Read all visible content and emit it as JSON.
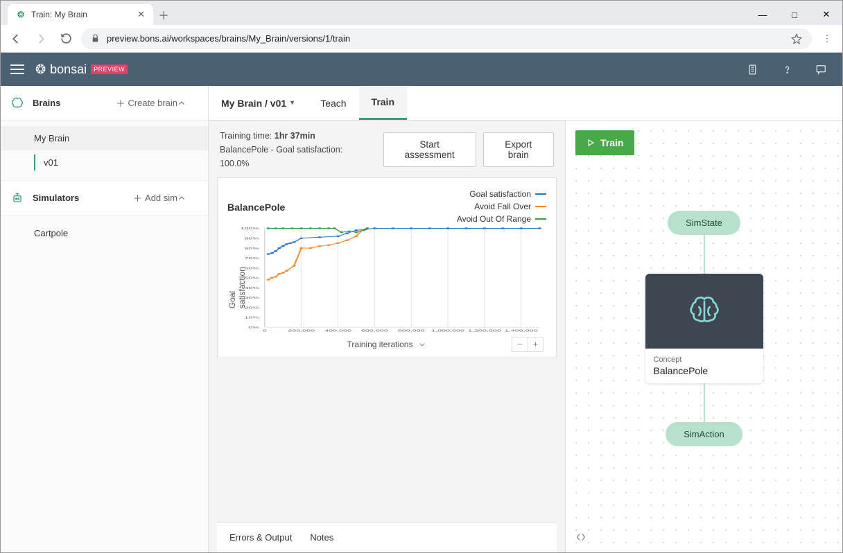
{
  "browser": {
    "tab_title": "Train: My Brain",
    "url_display": "preview.bons.ai/workspaces/brains/My_Brain/versions/1/train"
  },
  "topbar": {
    "brand": "bonsai",
    "badge": "PREVIEW"
  },
  "sidebar": {
    "brains_header": "Brains",
    "create_brain": "Create brain",
    "brain_name": "My Brain",
    "brain_version": "v01",
    "sims_header": "Simulators",
    "add_sim": "Add sim",
    "sim_name": "Cartpole"
  },
  "main": {
    "breadcrumb": "My Brain / v01",
    "tab_teach": "Teach",
    "tab_train": "Train",
    "training_time_label": "Training time:",
    "training_time_value": "1hr 37min",
    "goal_line": "BalancePole - Goal satisfaction:",
    "goal_value": "100.0%",
    "btn_assess": "Start assessment",
    "btn_export": "Export brain",
    "chart_title": "BalancePole",
    "xlabel": "Training iterations",
    "ylabel": "Goal satisfaction",
    "bottom_errors": "Errors & Output",
    "bottom_notes": "Notes"
  },
  "legend": {
    "s1": "Goal satisfaction",
    "s2": "Avoid Fall Over",
    "s3": "Avoid Out Of Range"
  },
  "right": {
    "train_btn": "Train",
    "node_top": "SimState",
    "concept_label": "Concept",
    "concept_name": "BalancePole",
    "node_bottom": "SimAction"
  },
  "colors": {
    "blue": "#2d72c9",
    "orange": "#f08b2c",
    "green": "#3a9b45"
  },
  "chart_data": {
    "type": "line",
    "title": "BalancePole",
    "xlabel": "Training iterations",
    "ylabel": "Goal satisfaction",
    "xlim": [
      0,
      1500000
    ],
    "ylim": [
      0,
      100
    ],
    "xticks": [
      0,
      200000,
      400000,
      600000,
      800000,
      1000000,
      1200000,
      1400000
    ],
    "xtick_labels": [
      "0",
      "200,000",
      "400,000",
      "600,000",
      "800,000",
      "1,000,000",
      "1,200,000",
      "1,400,000"
    ],
    "yticks": [
      0,
      10,
      20,
      30,
      40,
      50,
      60,
      70,
      80,
      90,
      100
    ],
    "ytick_labels": [
      "0%",
      "10%",
      "20%",
      "30%",
      "40%",
      "50%",
      "60%",
      "70%",
      "80%",
      "90%",
      "100%"
    ],
    "series": [
      {
        "name": "Goal satisfaction",
        "color": "#2d72c9",
        "x": [
          20000,
          40000,
          60000,
          80000,
          100000,
          120000,
          140000,
          160000,
          200000,
          300000,
          400000,
          450000,
          500000,
          550000,
          600000,
          700000,
          800000,
          900000,
          1000000,
          1100000,
          1200000,
          1300000,
          1400000,
          1500000
        ],
        "y": [
          74,
          75,
          77,
          80,
          82,
          84,
          85,
          86,
          90,
          91,
          92,
          95,
          98,
          99,
          100,
          100,
          100,
          100,
          100,
          100,
          100,
          100,
          100,
          100
        ]
      },
      {
        "name": "Avoid Fall Over",
        "color": "#f08b2c",
        "x": [
          20000,
          40000,
          60000,
          80000,
          100000,
          120000,
          160000,
          200000,
          250000,
          300000,
          350000,
          400000,
          450000,
          500000,
          530000,
          560000
        ],
        "y": [
          48,
          50,
          51,
          54,
          55,
          57,
          62,
          80,
          80,
          82,
          83,
          85,
          88,
          92,
          98,
          100
        ]
      },
      {
        "name": "Avoid Out Of Range",
        "color": "#3a9b45",
        "x": [
          20000,
          60000,
          100000,
          150000,
          200000,
          250000,
          300000,
          350000,
          380000,
          420000,
          460000,
          500000,
          540000,
          560000
        ],
        "y": [
          100,
          100,
          100,
          100,
          100,
          100,
          100,
          100,
          100,
          96,
          97,
          96,
          98,
          100
        ]
      }
    ]
  }
}
